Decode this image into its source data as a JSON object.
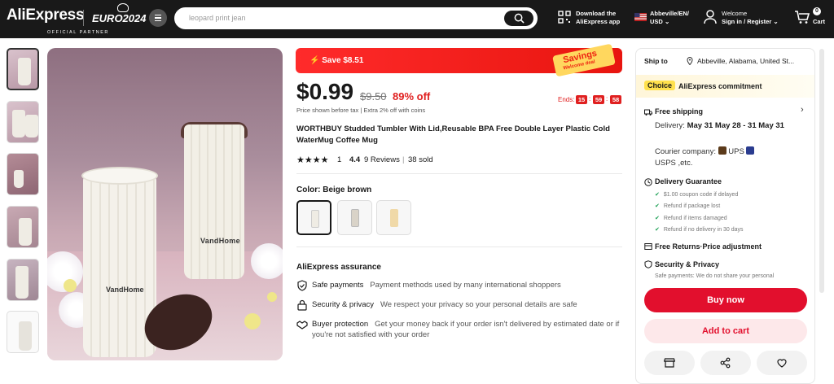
{
  "header": {
    "logo": "AliExpress",
    "official_partner": "OFFICIAL PARTNER",
    "euro": "EURO2024",
    "uefa": "UEFA",
    "search_placeholder": "leopard print jean",
    "download_line1": "Download the",
    "download_line2": "AliExpress app",
    "locale_line1": "Abbeville/EN/",
    "locale_line2": "USD",
    "welcome": "Welcome",
    "signin": "Sign in / Register",
    "cart_count": "0",
    "cart_label": "Cart"
  },
  "deal": {
    "save": "Save $8.51",
    "savings_tag": "Savings",
    "savings_sub": "Welcome deal"
  },
  "product": {
    "price": "$0.99",
    "old_price": "$9.50",
    "discount": "89% off",
    "price_note": "Price shown before tax  |  Extra 2% off with coins",
    "ends_label": "Ends:",
    "countdown": [
      "15",
      "59",
      "58"
    ],
    "title": "WORTHBUY Studded Tumbler With Lid,Reusable BPA Free Double Layer Plastic Cold WaterMug Coffee Mug",
    "stars": "★★★★",
    "star_count": "1",
    "rating": "4.4",
    "reviews": "9 Reviews",
    "sold": "38 sold",
    "color_label": "Color: Beige brown",
    "swatch_colors": [
      "#efece4",
      "#d9d3c8",
      "#f0d9a8"
    ],
    "image_label": "VandHome"
  },
  "assurance": {
    "title": "AliExpress assurance",
    "rows": [
      {
        "head": "Safe payments",
        "desc": "Payment methods used by many international shoppers"
      },
      {
        "head": "Security & privacy",
        "desc": "We respect your privacy so your personal details are safe"
      },
      {
        "head": "Buyer protection",
        "desc": "Get your money back if your order isn't delivered by estimated date or if you're not satisfied with your order"
      }
    ]
  },
  "panel": {
    "ship_to": "Ship to",
    "location": "Abbeville, Alabama, United St...",
    "choice": "Choice",
    "commitment": "AliExpress commitment",
    "free_shipping": "Free shipping",
    "delivery_label": "Delivery:",
    "delivery_dates": "May 31 May 28 - 31 May 31",
    "courier_label": "Courier company:",
    "courier": "UPS",
    "courier_2": "USPS ,etc.",
    "guarantee": "Delivery Guarantee",
    "guarantee_items": [
      "$1.00 coupon code if delayed",
      "Refund if package lost",
      "Refund if items damaged",
      "Refund if no delivery in 30 days"
    ],
    "free_returns": "Free Returns·Price adjustment",
    "sec_privacy": "Security & Privacy",
    "sec_note": "Safe payments: We do not share your personal",
    "buy_now": "Buy now",
    "add_to_cart": "Add to cart"
  },
  "colors": {
    "brand_red": "#e20f2d",
    "deal_red": "#e8150f",
    "choice_yellow": "#ffe14d",
    "header_bg": "#191919"
  }
}
